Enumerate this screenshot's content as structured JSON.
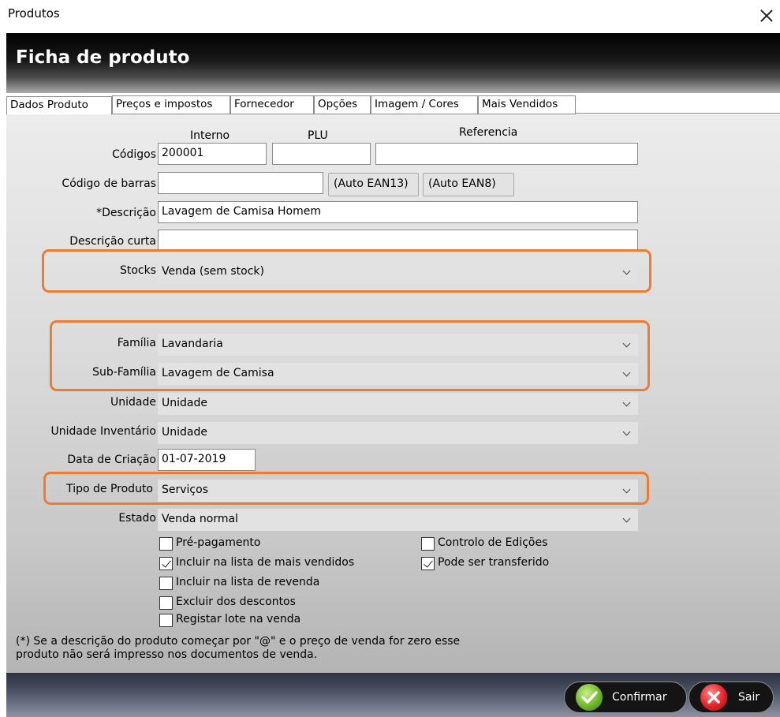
{
  "window": {
    "title": "Produtos"
  },
  "header": {
    "title": "Ficha de produto"
  },
  "tabs": [
    {
      "label": "Dados Produto"
    },
    {
      "label": "Preços e impostos"
    },
    {
      "label": "Fornecedor"
    },
    {
      "label": "Opções"
    },
    {
      "label": "Imagem / Cores"
    },
    {
      "label": "Mais Vendidos"
    }
  ],
  "form": {
    "col_interno": "Interno",
    "col_plu": "PLU",
    "col_referencia": "Referencia",
    "codigos_label": "Códigos",
    "interno_value": "200001",
    "plu_value": "",
    "referencia_value": "",
    "barras_label": "Código de barras",
    "barras_value": "",
    "auto_ean13": "(Auto EAN13)",
    "auto_ean8": "(Auto EAN8)",
    "descricao_label": "*Descrição",
    "descricao_value": "Lavagem de Camisa Homem",
    "descricao_curta_label": "Descrição curta",
    "descricao_curta_value": "",
    "stocks_label": "Stocks",
    "stocks_value": "Venda (sem stock)",
    "familia_label": "Família",
    "familia_value": "Lavandaria",
    "subfamilia_label": "Sub-Família",
    "subfamilia_value": "Lavagem de Camisa",
    "unidade_label": "Unidade",
    "unidade_value": "Unidade",
    "unidade_inv_label": "Unidade Inventário",
    "unidade_inv_value": "Unidade",
    "data_label": "Data de Criação",
    "data_value": "01-07-2019",
    "tipo_label": "Tipo de Produto",
    "tipo_value": "Serviços",
    "estado_label": "Estado",
    "estado_value": "Venda normal"
  },
  "checkboxes": {
    "pre_pagamento": {
      "label": "Pré-pagamento",
      "checked": false
    },
    "mais_vendidos": {
      "label": "Incluir na lista de mais vendidos",
      "checked": true
    },
    "revenda": {
      "label": "Incluir na lista de revenda",
      "checked": false
    },
    "descontos": {
      "label": "Excluir dos descontos",
      "checked": false
    },
    "lote": {
      "label": "Registar lote na venda",
      "checked": false
    },
    "controlo": {
      "label": "Controlo de Edições",
      "checked": false
    },
    "transferido": {
      "label": "Pode ser transferido",
      "checked": true
    }
  },
  "note": {
    "line1": "(*) Se a descrição do produto começar por \"@\" e o preço de venda for zero  esse",
    "line2": "produto não será impresso nos documentos de venda."
  },
  "footer": {
    "confirm_label": "Confirmar",
    "exit_label": "Sair"
  },
  "colors": {
    "highlight": "#ee7b32",
    "header_bg": "#000000"
  }
}
